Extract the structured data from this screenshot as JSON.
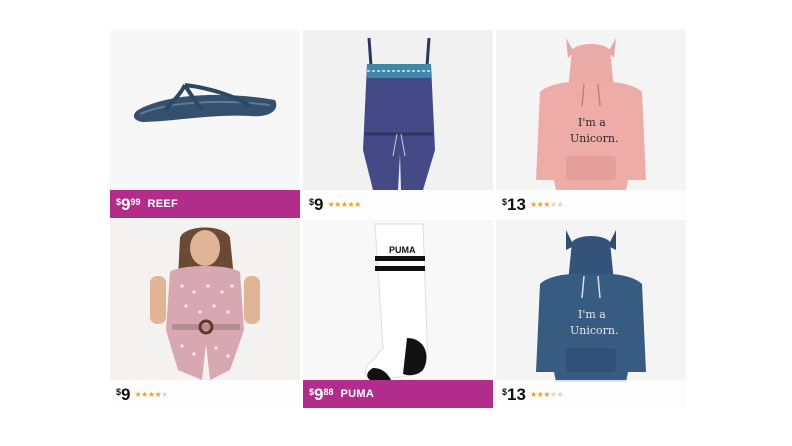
{
  "products": [
    {
      "name": "flip-flop",
      "price_symbol": "$",
      "price_whole": "9",
      "price_fraction": "99",
      "brand": "REEF",
      "deal": true,
      "rating": null
    },
    {
      "name": "romper",
      "price_symbol": "$",
      "price_whole": "9",
      "price_fraction": "",
      "brand": "",
      "deal": false,
      "rating": 5
    },
    {
      "name": "pink-unicorn-hoodie",
      "price_symbol": "$",
      "price_whole": "13",
      "price_fraction": "",
      "brand": "",
      "deal": false,
      "rating": 3,
      "print_text": "I'm a Unicorn."
    },
    {
      "name": "pink-romper",
      "price_symbol": "$",
      "price_whole": "9",
      "price_fraction": "",
      "brand": "",
      "deal": false,
      "rating": 4
    },
    {
      "name": "sock",
      "price_symbol": "$",
      "price_whole": "9",
      "price_fraction": "88",
      "brand": "PUMA",
      "deal": true,
      "rating": null,
      "logo_text": "PUMA"
    },
    {
      "name": "navy-unicorn-hoodie",
      "price_symbol": "$",
      "price_whole": "13",
      "price_fraction": "",
      "brand": "",
      "deal": false,
      "rating": 3,
      "print_text": "I'm a Unicorn."
    }
  ],
  "colors": {
    "deal_bar": "#b22c8c",
    "star": "#f0a11f"
  }
}
